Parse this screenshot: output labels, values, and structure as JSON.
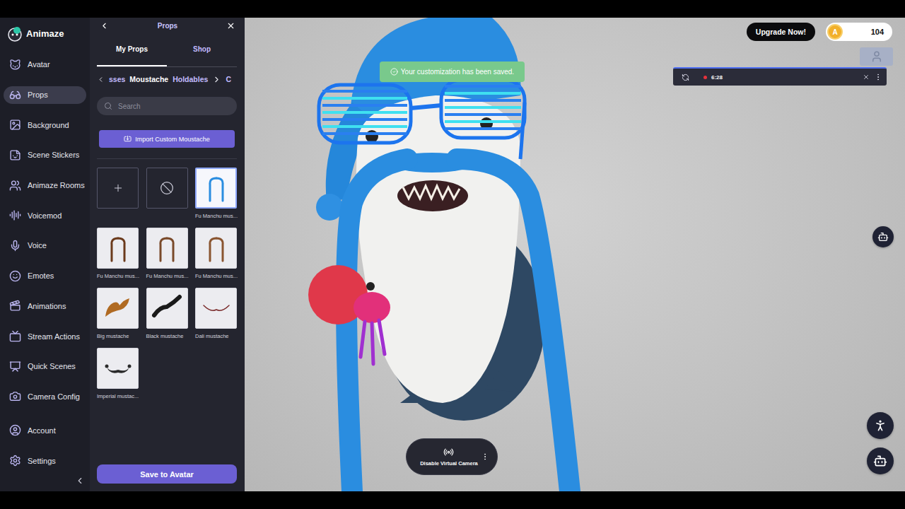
{
  "app": {
    "logo": "Animaze"
  },
  "nav": {
    "items": [
      {
        "label": "Avatar",
        "selected": false
      },
      {
        "label": "Props",
        "selected": true
      },
      {
        "label": "Background",
        "selected": false
      },
      {
        "label": "Scene Stickers",
        "selected": false
      },
      {
        "label": "Animaze Rooms",
        "selected": false
      },
      {
        "label": "Voicemod",
        "selected": false
      },
      {
        "label": "Voice",
        "selected": false
      },
      {
        "label": "Emotes",
        "selected": false
      },
      {
        "label": "Animations",
        "selected": false
      },
      {
        "label": "Stream Actions",
        "selected": false
      },
      {
        "label": "Quick Scenes",
        "selected": false
      },
      {
        "label": "Camera Config",
        "selected": false
      }
    ],
    "footer": [
      {
        "label": "Account"
      },
      {
        "label": "Settings"
      }
    ]
  },
  "panel": {
    "title": "Props",
    "tabs": [
      {
        "label": "My Props",
        "selected": true
      },
      {
        "label": "Shop",
        "selected": false
      }
    ],
    "categories": [
      {
        "label": "sses",
        "selected": false
      },
      {
        "label": "Moustache",
        "selected": true
      },
      {
        "label": "Holdables",
        "selected": false
      },
      {
        "label": "C",
        "selected": false
      }
    ],
    "search": {
      "placeholder": "Search"
    },
    "import_button": "Import Custom Moustache",
    "items": [
      {
        "kind": "add",
        "selected": false
      },
      {
        "kind": "none",
        "selected": false
      },
      {
        "label": "Fu Manchu mus...",
        "kind": "fu-manchu",
        "color": "#2a8de0",
        "selected": true
      },
      {
        "label": "Fu Manchu mus...",
        "kind": "fu-manchu",
        "color": "#6b3a1c",
        "selected": false
      },
      {
        "label": "Fu Manchu mus...",
        "kind": "fu-manchu",
        "color": "#7a4a2a",
        "selected": false
      },
      {
        "label": "Fu Manchu mus...",
        "kind": "fu-manchu",
        "color": "#8a5530",
        "selected": false
      },
      {
        "label": "Big mustache",
        "kind": "big",
        "color": "#b06a22",
        "selected": false
      },
      {
        "label": "Black mustache",
        "kind": "black",
        "color": "#1a1a1a",
        "selected": false
      },
      {
        "label": "Dali mustache",
        "kind": "dali",
        "color": "#7a2a2a",
        "selected": false
      },
      {
        "label": "Imperial mustac...",
        "kind": "imperial",
        "color": "#2a2a2a",
        "selected": false
      }
    ],
    "save_button": "Save to Avatar"
  },
  "toast": {
    "text": "Your customization has been saved."
  },
  "upgrade_button": "Upgrade Now!",
  "coins": {
    "symbol": "A",
    "value": "104"
  },
  "recording": {
    "time": "6:28",
    "active": true
  },
  "virtual_camera": {
    "label": "Disable Virtual Camera"
  }
}
